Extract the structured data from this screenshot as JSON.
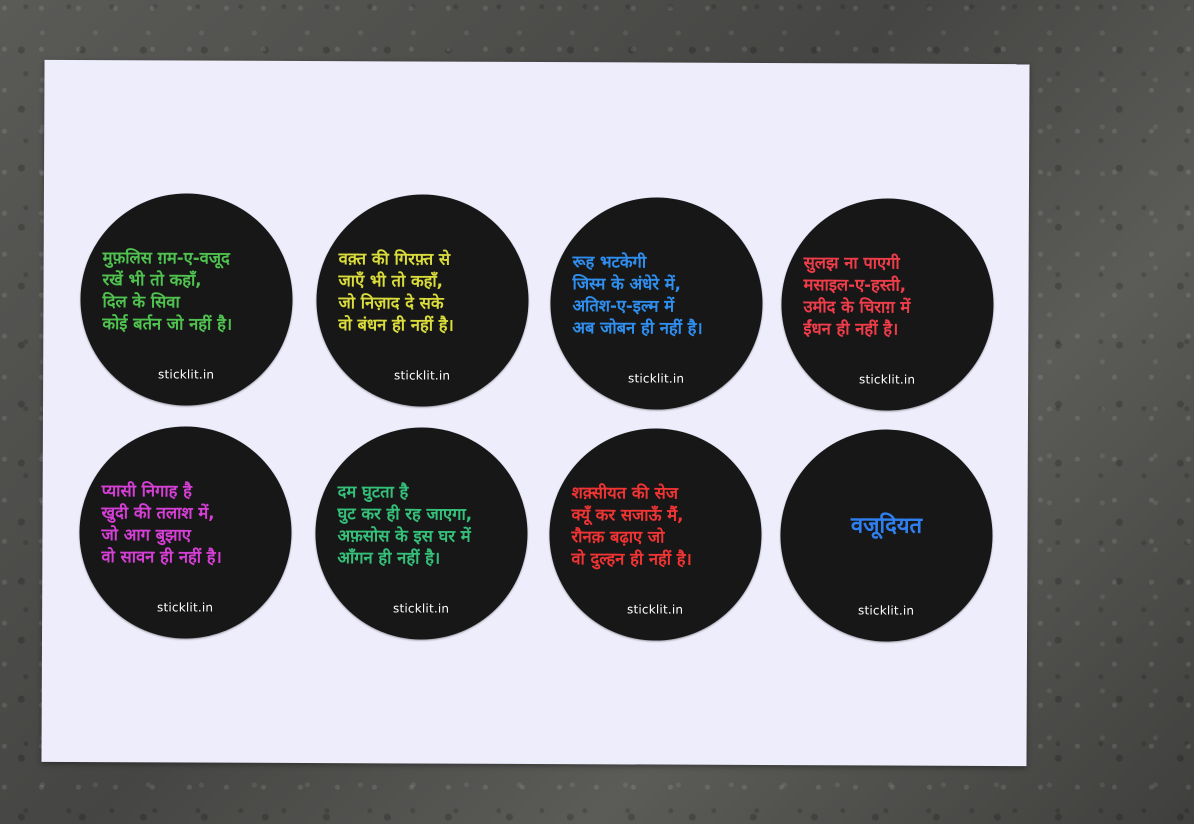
{
  "background": "concrete wall",
  "paper_color": "#eeedfc",
  "sticker_color": "#171717",
  "stickers": [
    {
      "lines": "मुफ़लिस ग़म-ए-वजूद\nरखें भी तो कहाँ,\nदिल के सिवा\nकोई बर्तन जो नहीं है।",
      "color": "#4fc24f",
      "site": "sticklit.in"
    },
    {
      "lines": "वक़्त की गिरफ़्त से\nजाएँ भी तो कहाँ,\nजो निज़ाद दे सके\nवो बंधन ही नहीं है।",
      "color": "#d9dc3a",
      "site": "sticklit.in"
    },
    {
      "lines": "रूह भटकेगी\nजिस्म के अंधेरे में,\nअतिश-ए-इल्म में\nअब जोबन ही नहीं है।",
      "color": "#2f8ff0",
      "site": "sticklit.in"
    },
    {
      "lines": "सुलझ ना पाएगी\nमसाइल-ए-हस्ती,\nउमीद के चिराग़ में\nईंधन ही नहीं है।",
      "color": "#ef3d4a",
      "site": "sticklit.in"
    },
    {
      "lines": "प्यासी निगाह है\nखुदी की तलाश में,\nजो आग बुझाए\nवो सावन ही नहीं है।",
      "color": "#d63fd6",
      "site": "sticklit.in"
    },
    {
      "lines": "दम घुटता है\nघुट कर ही रह जाएगा,\nअफ़सोस के इस घर में\nआँगन ही नहीं है।",
      "color": "#35c07a",
      "site": "sticklit.in"
    },
    {
      "lines": "शक़्सीयत की सेज\nक्यूँ कर सजाऊँ मैं,\nरौनक़ बढ़ाए जो\nवो दुल्हन ही नहीं है।",
      "color": "#f03434",
      "site": "sticklit.in"
    },
    {
      "title": "वजूदियत",
      "color": "#2f7ff0",
      "site": "sticklit.in"
    }
  ]
}
